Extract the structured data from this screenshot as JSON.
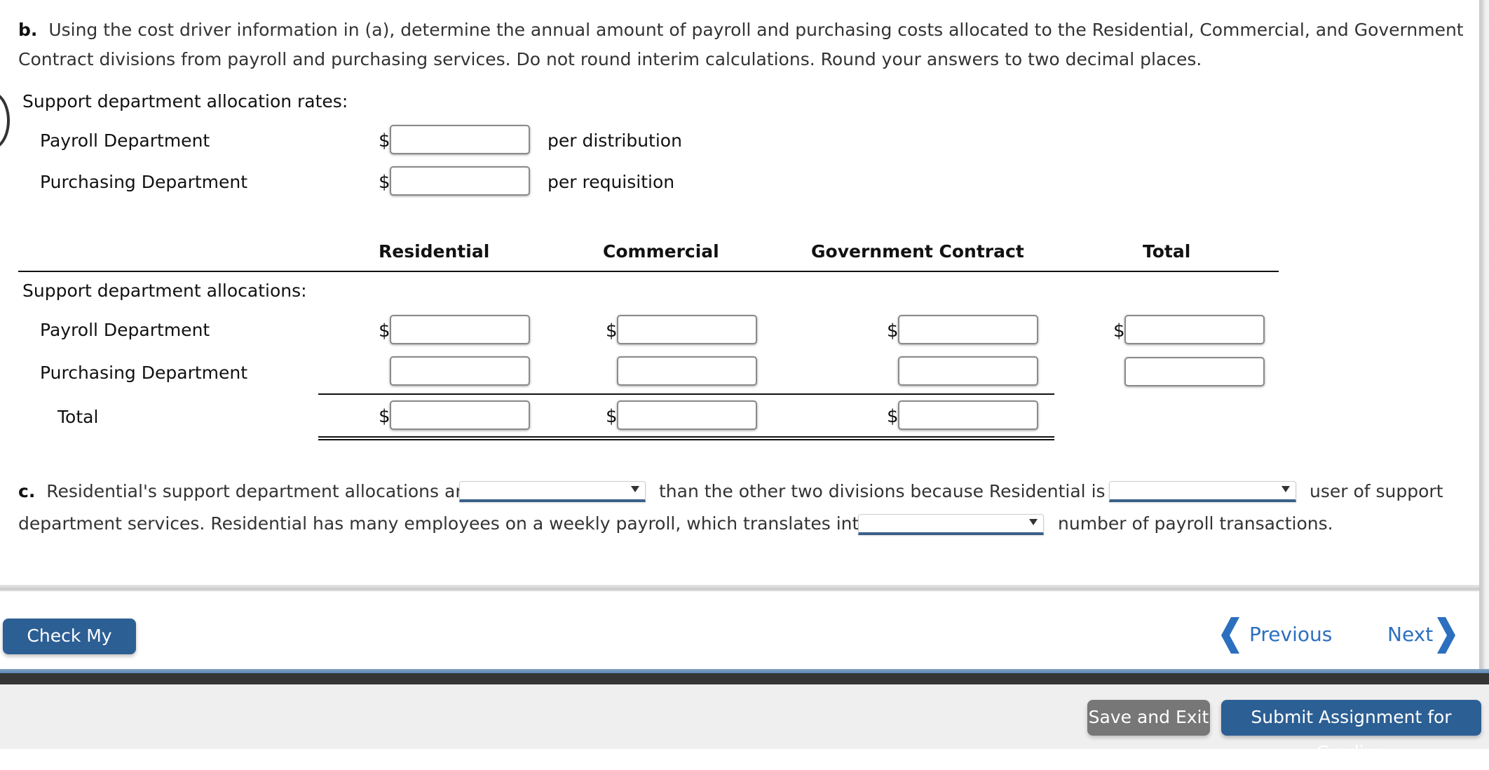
{
  "question": {
    "part_b_label": "b.",
    "part_b_text_line1": "Using the cost driver information in (a), determine the annual amount of payroll and purchasing costs allocated to the Residential, Commercial, and Government",
    "part_b_text_line2": "Contract divisions from payroll and purchasing services. Do not round interim calculations. Round your answers to two decimal places."
  },
  "rates": {
    "heading": "Support department allocation rates:",
    "rows": [
      {
        "label": "Payroll Department",
        "currency": "$",
        "value": "",
        "unit": "per distribution"
      },
      {
        "label": "Purchasing Department",
        "currency": "$",
        "value": "",
        "unit": "per requisition"
      }
    ]
  },
  "allocations": {
    "columns": [
      "Residential",
      "Commercial",
      "Government Contract",
      "Total"
    ],
    "heading": "Support department allocations:",
    "rows": [
      {
        "label": "Payroll Department",
        "currency": "$",
        "values": [
          "",
          "",
          "",
          ""
        ]
      },
      {
        "label": "Purchasing Department",
        "currency": "",
        "values": [
          "",
          "",
          "",
          ""
        ]
      },
      {
        "label": "Total",
        "currency": "$",
        "values": [
          "",
          "",
          ""
        ]
      }
    ]
  },
  "part_c": {
    "label": "c.",
    "seg1": "Residential's support department allocations are",
    "seg2": "than the other two divisions because Residential is a",
    "seg3": "user of support",
    "seg4": "department services. Residential has many employees on a weekly payroll, which translates into a",
    "seg5": "number of payroll transactions.",
    "dropdowns": [
      {
        "selected": ""
      },
      {
        "selected": ""
      },
      {
        "selected": ""
      }
    ]
  },
  "footer": {
    "check_my_work": "Check My Work",
    "previous": "Previous",
    "next": "Next",
    "save_and_exit": "Save and Exit",
    "submit": "Submit Assignment for Grading"
  },
  "colors": {
    "primary_button": "#2c5f94",
    "nav_link": "#2c6fbf",
    "secondary_button": "#777777",
    "dropdown_underline": "#3a6089"
  }
}
